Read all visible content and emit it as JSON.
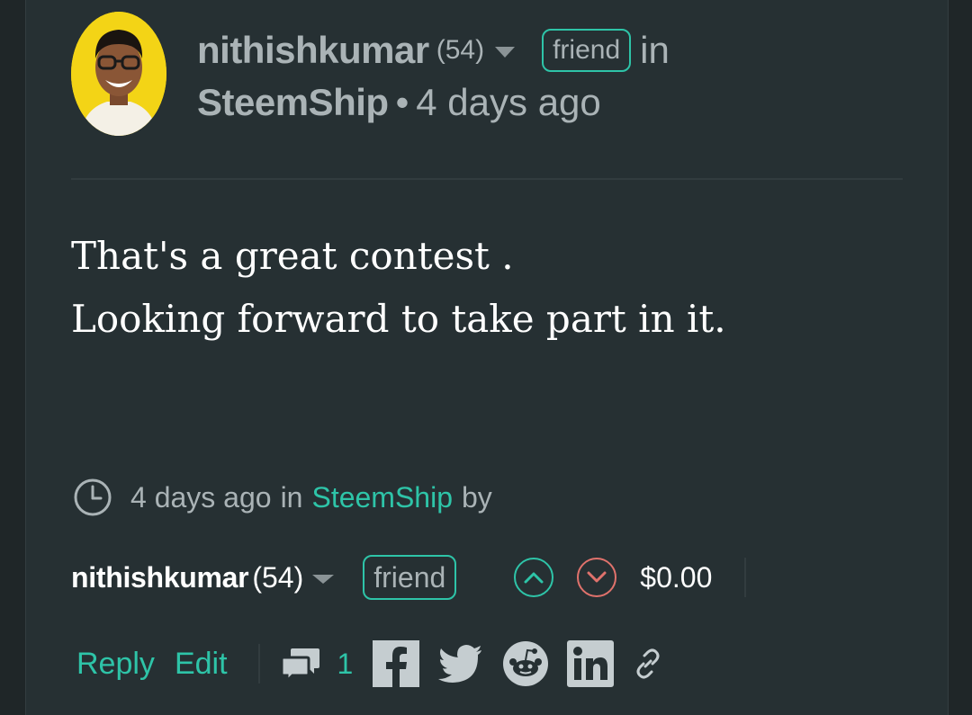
{
  "post": {
    "author": "nithishkumar",
    "reputation": "(54)",
    "relationship_badge": "friend",
    "in_word": "in",
    "community": "SteemShip",
    "separator": "•",
    "time_ago": "4 days ago",
    "body_lines": [
      "That's a great contest .",
      "Looking forward to take part in it."
    ]
  },
  "meta": {
    "time_ago": "4 days ago",
    "in_word": "in",
    "community": "SteemShip",
    "by_word": "by"
  },
  "footer": {
    "author": "nithishkumar",
    "reputation": "(54)",
    "relationship_badge": "friend",
    "payout": "$0.00",
    "reply_label": "Reply",
    "edit_label": "Edit",
    "comment_count": "1"
  },
  "icons": {
    "upvote": "chevron-up-circle-icon",
    "downvote": "chevron-down-circle-icon",
    "comments": "comments-icon",
    "clock": "clock-icon",
    "share": [
      "facebook-icon",
      "twitter-icon",
      "reddit-icon",
      "linkedin-icon",
      "link-icon"
    ]
  },
  "colors": {
    "background": "#1f2628",
    "card": "#263033",
    "accent": "#2ec4a8",
    "downvote": "#e0726c",
    "muted_text": "#aab3b6",
    "text": "#ffffff"
  }
}
